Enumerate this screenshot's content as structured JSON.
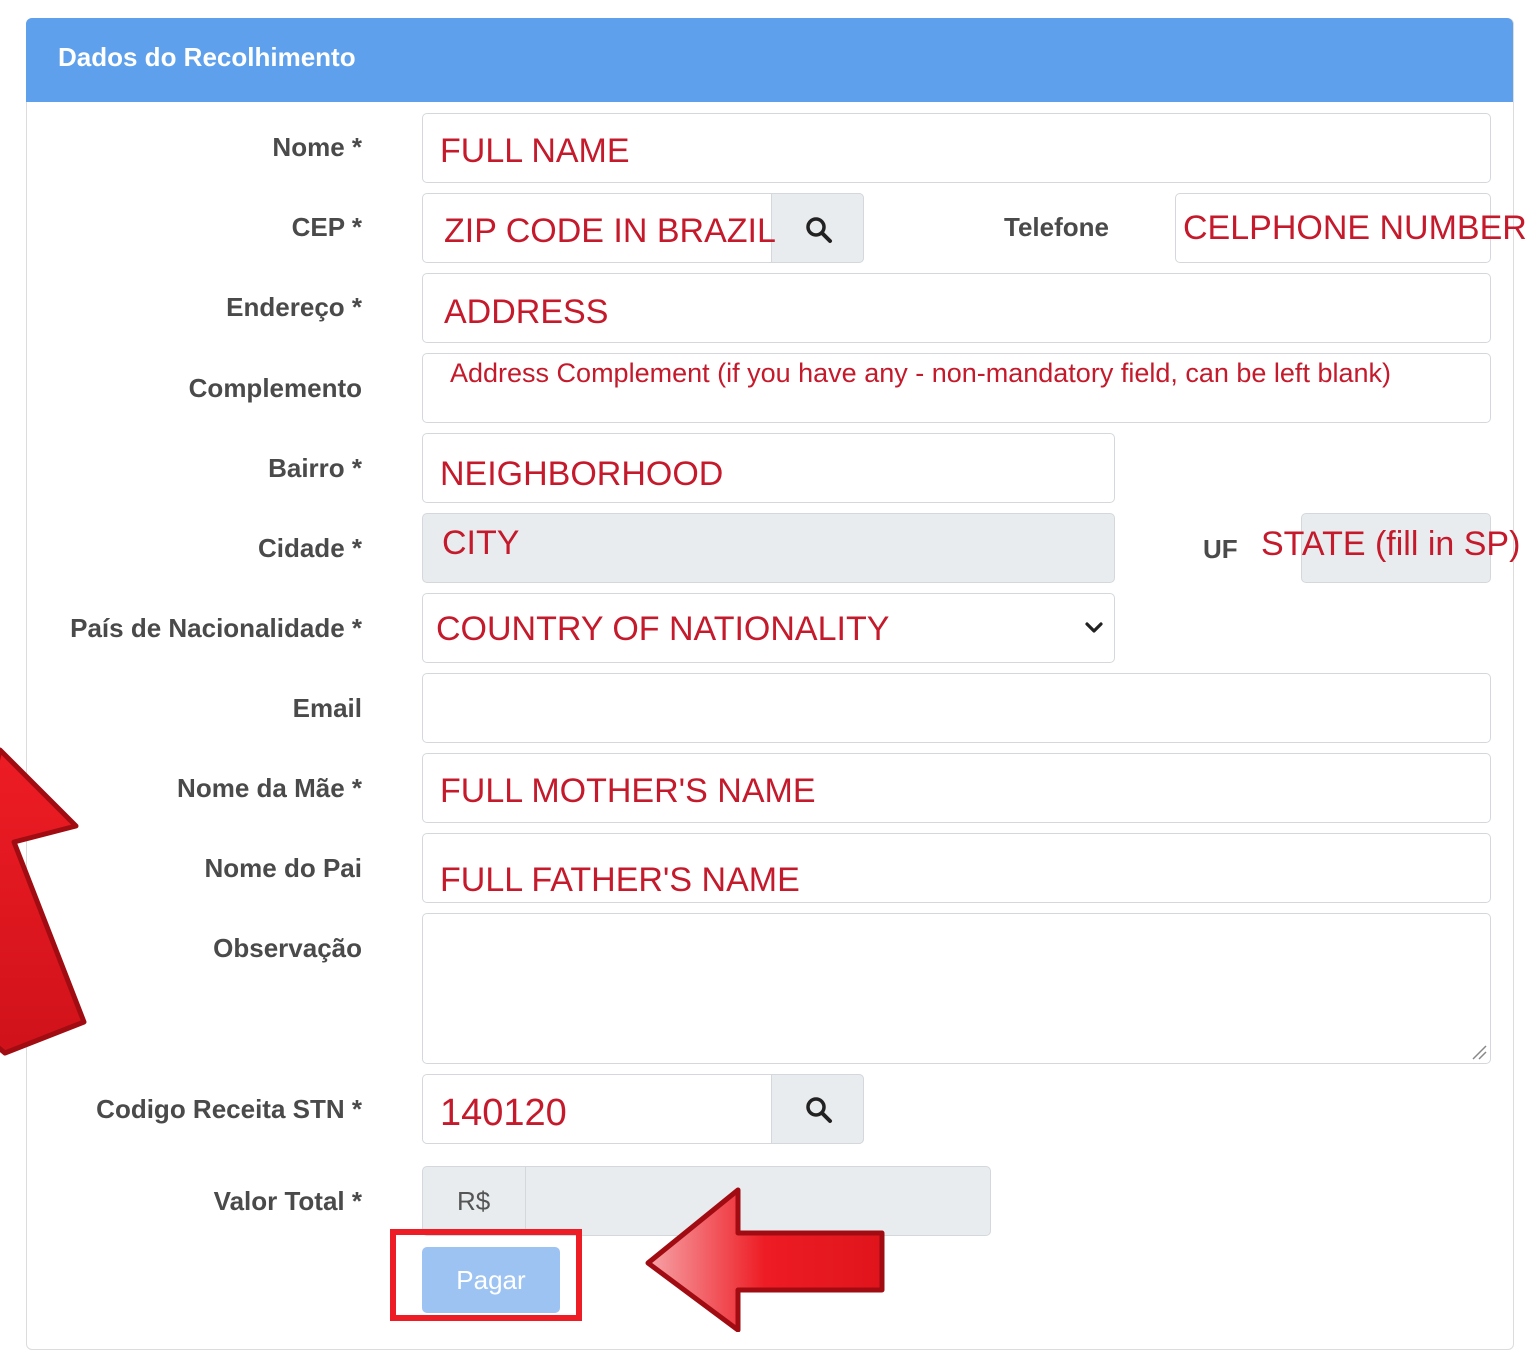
{
  "panel": {
    "title": "Dados do Recolhimento"
  },
  "labels": {
    "nome": "Nome *",
    "cep": "CEP *",
    "telefone": "Telefone",
    "endereco": "Endereço *",
    "complemento": "Complemento",
    "bairro": "Bairro *",
    "cidade": "Cidade *",
    "uf": "UF",
    "pais": "País de Nacionalidade *",
    "email": "Email",
    "nome_mae": "Nome da Mãe *",
    "nome_pai": "Nome do Pai",
    "observacao": "Observação",
    "codigo": "Codigo Receita STN *",
    "valor": "Valor Total *"
  },
  "values": {
    "nome": "FULL NAME",
    "cep": "ZIP CODE IN BRAZIL",
    "telefone": "CELPHONE NUMBER",
    "endereco": "ADDRESS",
    "complemento": "Address Complement (if you have any - non-mandatory field, can be left blank)",
    "bairro": "NEIGHBORHOOD",
    "cidade": "CITY",
    "uf": "STATE (fill in SP)",
    "pais": "COUNTRY OF NATIONALITY",
    "email": "",
    "nome_mae": "FULL MOTHER'S NAME",
    "nome_pai": "FULL FATHER'S NAME",
    "observacao": "",
    "codigo": "140120",
    "valor": ""
  },
  "valor_prefix": "R$",
  "buttons": {
    "pagar": "Pagar"
  },
  "icons": {
    "search": "search-icon",
    "dropdown": "chevron-down-icon",
    "resize": "resize-handle-icon"
  },
  "colors": {
    "header": "#5ea0ec",
    "annotation": "#ee1c24",
    "value_text": "#c41a2b",
    "button": "#9dc3f2"
  }
}
